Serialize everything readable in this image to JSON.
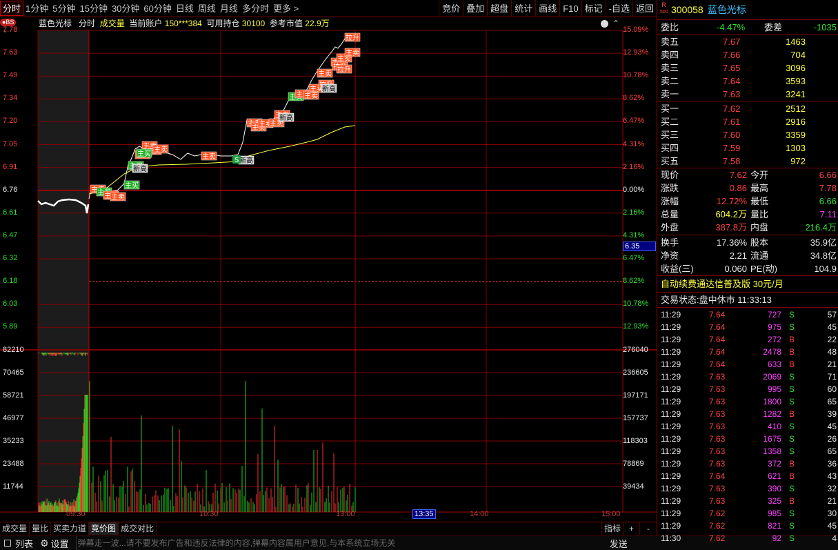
{
  "topbar": {
    "tabs": [
      "分时",
      "1分钟",
      "5分钟",
      "15分钟",
      "30分钟",
      "60分钟",
      "日线",
      "周线",
      "月线",
      "多分时",
      "更多 >"
    ],
    "right_buttons": [
      "竞价",
      "叠加",
      "超盘",
      "统计",
      "画线",
      "F10",
      "标记",
      "-自选",
      "返回"
    ]
  },
  "chart_header": {
    "bs_badge": "●BS",
    "stock_name": "蓝色光标",
    "mode": "分时",
    "indicator": "成交量",
    "account_label": "当前账户",
    "account": "150***384",
    "position_label": "可用持仓",
    "position": "30100",
    "value_label": "参考市值",
    "value": "22.9万",
    "close_x": "×"
  },
  "price_axis": {
    "left": [
      "7.78",
      "7.63",
      "7.49",
      "7.34",
      "7.20",
      "7.05",
      "6.91",
      "6.76",
      "6.61",
      "6.47",
      "6.32",
      "6.18",
      "6.03",
      "5.89"
    ],
    "right": [
      "15.09%",
      "12.93%",
      "10.78%",
      "8.62%",
      "6.47%",
      "4.31%",
      "2.16%",
      "0.00%",
      "2.16%",
      "4.31%",
      "6.47%",
      "8.62%",
      "10.78%",
      "12.93%"
    ],
    "cursor_price": "6.35"
  },
  "volume_axis": {
    "left": [
      "82210",
      "70465",
      "58721",
      "46977",
      "35233",
      "23488",
      "11744"
    ],
    "right": [
      "276040",
      "236605",
      "197171",
      "157737",
      "118303",
      "78869",
      "39434"
    ]
  },
  "time_axis": [
    "09:30",
    "10:30",
    "13:00",
    "13:35",
    "14:00",
    "15:00"
  ],
  "signals": [
    "主卖",
    "主买",
    "主卖",
    "主卖",
    "主买",
    "主卖",
    "主买",
    "新高",
    "主卖",
    "主卖",
    "主卖",
    "主买",
    "主卖",
    "新高",
    "主卖",
    "主卖",
    "主卖",
    "主卖",
    "主卖",
    "新高",
    "主买",
    "主卖",
    "主卖",
    "主卖",
    "主卖",
    "拉升",
    "新高",
    "主卖",
    "主卖",
    "拉升",
    "主卖",
    "拉升",
    "拉升"
  ],
  "bottom_tabs": [
    "成交量",
    "量比",
    "买卖力道",
    "竞价图",
    "成交对比"
  ],
  "bottom_right": {
    "indicator": "指标",
    "plus": "+",
    "minus": "-"
  },
  "statusbar": {
    "list": "列表",
    "settings": "设置",
    "marquee": "弹幕走一波...请不要发布广告和违反法律的内容,弹幕内容属用户意见,与本系统立场无关",
    "send": "发送"
  },
  "quote": {
    "code": "300058",
    "name": "蓝色光标",
    "r_badge": "R",
    "r_sub": "500",
    "weibi_label": "委比",
    "weibi": "-4.47%",
    "weicha_label": "委差",
    "weicha": "-1035",
    "asks": [
      {
        "label": "卖五",
        "price": "7.67",
        "vol": "1463"
      },
      {
        "label": "卖四",
        "price": "7.66",
        "vol": "704"
      },
      {
        "label": "卖三",
        "price": "7.65",
        "vol": "3096"
      },
      {
        "label": "卖二",
        "price": "7.64",
        "vol": "3593"
      },
      {
        "label": "卖一",
        "price": "7.63",
        "vol": "3241"
      }
    ],
    "bids": [
      {
        "label": "买一",
        "price": "7.62",
        "vol": "2512"
      },
      {
        "label": "买二",
        "price": "7.61",
        "vol": "2916"
      },
      {
        "label": "买三",
        "price": "7.60",
        "vol": "3359"
      },
      {
        "label": "买四",
        "price": "7.59",
        "vol": "1303"
      },
      {
        "label": "买五",
        "price": "7.58",
        "vol": "972"
      }
    ],
    "stats": [
      {
        "l1": "现价",
        "v1": "7.62",
        "l2": "今开",
        "v2": "6.66"
      },
      {
        "l1": "涨跌",
        "v1": "0.86",
        "l2": "最高",
        "v2": "7.78"
      },
      {
        "l1": "涨幅",
        "v1": "12.72%",
        "l2": "最低",
        "v2": "6.66"
      },
      {
        "l1": "总量",
        "v1": "604.2万",
        "l2": "量比",
        "v2": "7.11"
      },
      {
        "l1": "外盘",
        "v1": "387.8万",
        "l2": "内盘",
        "v2": "216.4万"
      }
    ],
    "stats2": [
      {
        "l1": "换手",
        "v1": "17.36%",
        "l2": "股本",
        "v2": "35.9亿"
      },
      {
        "l1": "净资",
        "v1": "2.21",
        "l2": "流通",
        "v2": "34.8亿"
      },
      {
        "l1": "收益(三)",
        "v1": "0.060",
        "l2": "PE(动)",
        "v2": "104.9"
      }
    ],
    "promo": "自动续费通达信普及版",
    "promo_price": "30元/月",
    "status_label": "交易状态:",
    "status": "盘中休市",
    "status_time": "11:33:13",
    "ticks": [
      {
        "t": "11:29",
        "p": "7.64",
        "v": "727",
        "d": "S",
        "n": "57"
      },
      {
        "t": "11:29",
        "p": "7.64",
        "v": "975",
        "d": "S",
        "n": "45"
      },
      {
        "t": "11:29",
        "p": "7.64",
        "v": "272",
        "d": "B",
        "n": "22"
      },
      {
        "t": "11:29",
        "p": "7.64",
        "v": "2478",
        "d": "B",
        "n": "48"
      },
      {
        "t": "11:29",
        "p": "7.64",
        "v": "633",
        "d": "B",
        "n": "21"
      },
      {
        "t": "11:29",
        "p": "7.63",
        "v": "2069",
        "d": "S",
        "n": "71"
      },
      {
        "t": "11:29",
        "p": "7.63",
        "v": "995",
        "d": "S",
        "n": "60"
      },
      {
        "t": "11:29",
        "p": "7.63",
        "v": "1800",
        "d": "S",
        "n": "65"
      },
      {
        "t": "11:29",
        "p": "7.63",
        "v": "1282",
        "d": "B",
        "n": "39"
      },
      {
        "t": "11:29",
        "p": "7.63",
        "v": "410",
        "d": "S",
        "n": "45"
      },
      {
        "t": "11:29",
        "p": "7.63",
        "v": "1675",
        "d": "S",
        "n": "26"
      },
      {
        "t": "11:29",
        "p": "7.63",
        "v": "1358",
        "d": "S",
        "n": "65"
      },
      {
        "t": "11:29",
        "p": "7.63",
        "v": "372",
        "d": "B",
        "n": "36"
      },
      {
        "t": "11:29",
        "p": "7.64",
        "v": "621",
        "d": "B",
        "n": "43"
      },
      {
        "t": "11:29",
        "p": "7.63",
        "v": "390",
        "d": "S",
        "n": "32"
      },
      {
        "t": "11:29",
        "p": "7.63",
        "v": "325",
        "d": "B",
        "n": "21"
      },
      {
        "t": "11:29",
        "p": "7.62",
        "v": "985",
        "d": "S",
        "n": "30"
      },
      {
        "t": "11:29",
        "p": "7.62",
        "v": "821",
        "d": "S",
        "n": "45"
      },
      {
        "t": "11:30",
        "p": "7.62",
        "v": "92",
        "d": "S",
        "n": "4"
      }
    ]
  },
  "colors": {
    "up": "#ff4040",
    "down": "#30e030",
    "grid": "#800000",
    "avg": "#ffff40",
    "price_line": "#ffffff"
  }
}
